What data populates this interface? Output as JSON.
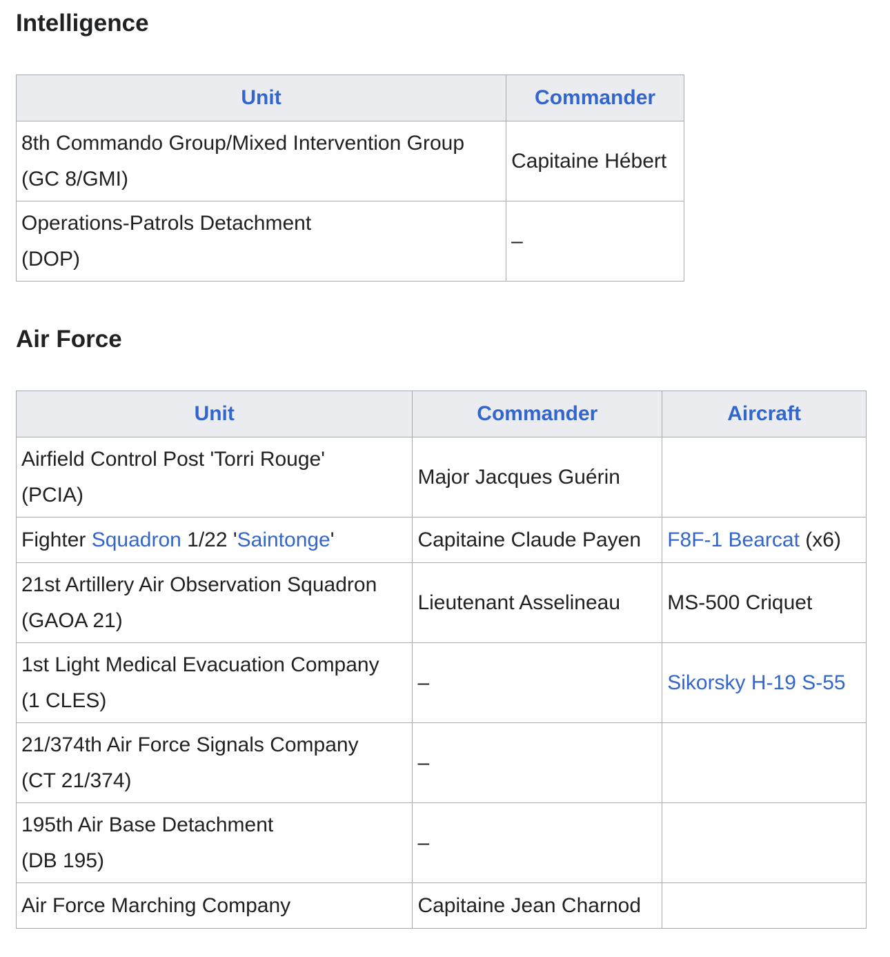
{
  "intelligence": {
    "heading": "Intelligence",
    "columns": [
      "Unit",
      "Commander"
    ],
    "rows": [
      {
        "unit_line1": "8th Commando Group/Mixed Intervention Group",
        "unit_line2": "(GC 8/GMI)",
        "commander": "Capitaine Hébert"
      },
      {
        "unit_line1": "Operations-Patrols Detachment",
        "unit_line2": "(DOP)",
        "commander": "–"
      }
    ]
  },
  "air_force": {
    "heading": "Air Force",
    "columns": [
      "Unit",
      "Commander",
      "Aircraft"
    ],
    "rows": [
      {
        "unit_line1": "Airfield Control Post 'Torri Rouge'",
        "unit_line2": "(PCIA)",
        "commander": "Major Jacques Guérin",
        "aircraft": ""
      },
      {
        "unit_parts": [
          "Fighter ",
          "Squadron",
          " 1/22 '",
          "Saintonge",
          "'"
        ],
        "commander": "Capitaine Claude Payen",
        "aircraft_link": "F8F-1 Bearcat",
        "aircraft_suffix": " (x6)"
      },
      {
        "unit_line1": "21st Artillery Air Observation Squadron",
        "unit_line2": "(GAOA 21)",
        "commander": "Lieutenant Asselineau",
        "aircraft": "MS-500 Criquet"
      },
      {
        "unit_line1": "1st Light Medical Evacuation Company",
        "unit_line2": "(1 CLES)",
        "commander": "–",
        "aircraft_link": "Sikorsky H-19 S-55"
      },
      {
        "unit_line1": "21/374th Air Force Signals Company",
        "unit_line2": "(CT 21/374)",
        "commander": "–",
        "aircraft": ""
      },
      {
        "unit_line1": "195th Air Base Detachment",
        "unit_line2": "(DB 195)",
        "commander": "–",
        "aircraft": ""
      },
      {
        "unit": "Air Force Marching Company",
        "commander": "Capitaine Jean Charnod",
        "aircraft": ""
      }
    ]
  },
  "colors": {
    "link": "#3366cc",
    "header_bg": "#eaecf0",
    "border": "#a2a9b1",
    "text": "#202122"
  }
}
